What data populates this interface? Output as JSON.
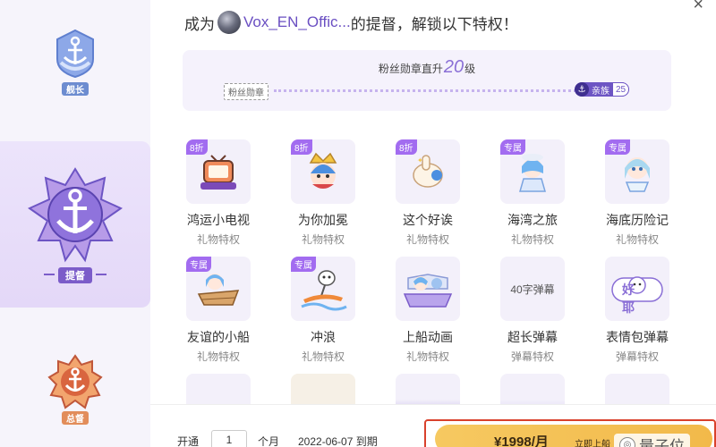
{
  "sidebar": {
    "tiers": [
      {
        "label": "舰长"
      },
      {
        "label": "提督"
      },
      {
        "label": "总督"
      }
    ]
  },
  "header": {
    "prefix": "成为",
    "anchor_name": "Vox_EN_Offic...",
    "suffix": "的提督，解锁以下特权！",
    "close_symbol": "×"
  },
  "progress": {
    "title_prefix": "粉丝勋章直升",
    "level": "20",
    "title_suffix": "级",
    "from_label": "粉丝勋章",
    "to_name": "亲族",
    "to_level": "25"
  },
  "perks": [
    {
      "tag": "8折",
      "name": "鸿运小电视",
      "type": "礼物特权",
      "art": "tv"
    },
    {
      "tag": "8折",
      "name": "为你加冕",
      "type": "礼物特权",
      "art": "crown"
    },
    {
      "tag": "8折",
      "name": "这个好诶",
      "type": "礼物特权",
      "art": "thumb"
    },
    {
      "tag": "专属",
      "name": "海湾之旅",
      "type": "礼物特权",
      "art": "bay"
    },
    {
      "tag": "专属",
      "name": "海底历险记",
      "type": "礼物特权",
      "art": "sea"
    },
    {
      "tag": "专属",
      "name": "友谊的小船",
      "type": "礼物特权",
      "art": "boat"
    },
    {
      "tag": "专属",
      "name": "冲浪",
      "type": "礼物特权",
      "art": "surf"
    },
    {
      "tag": "",
      "name": "上船动画",
      "type": "礼物特权",
      "art": "ship"
    },
    {
      "tag": "",
      "name": "超长弹幕",
      "type": "弹幕特权",
      "art": "text",
      "thumb_text": "40字弹幕"
    },
    {
      "tag": "",
      "name": "表情包弹幕",
      "type": "弹幕特权",
      "art": "emoji",
      "thumb_text": "好耶"
    }
  ],
  "footer": {
    "open_label": "开通",
    "months": "1",
    "month_label": "个月",
    "expire_text": "2022-06-07 到期",
    "price": "¥1998/月",
    "buy_sub": "立即上船",
    "watermark": "量子位"
  },
  "colors": {
    "accent": "#8a6fd6",
    "tag": "#a26cf0",
    "buy": "#f2b94a",
    "highlight_frame": "#d9412c"
  }
}
